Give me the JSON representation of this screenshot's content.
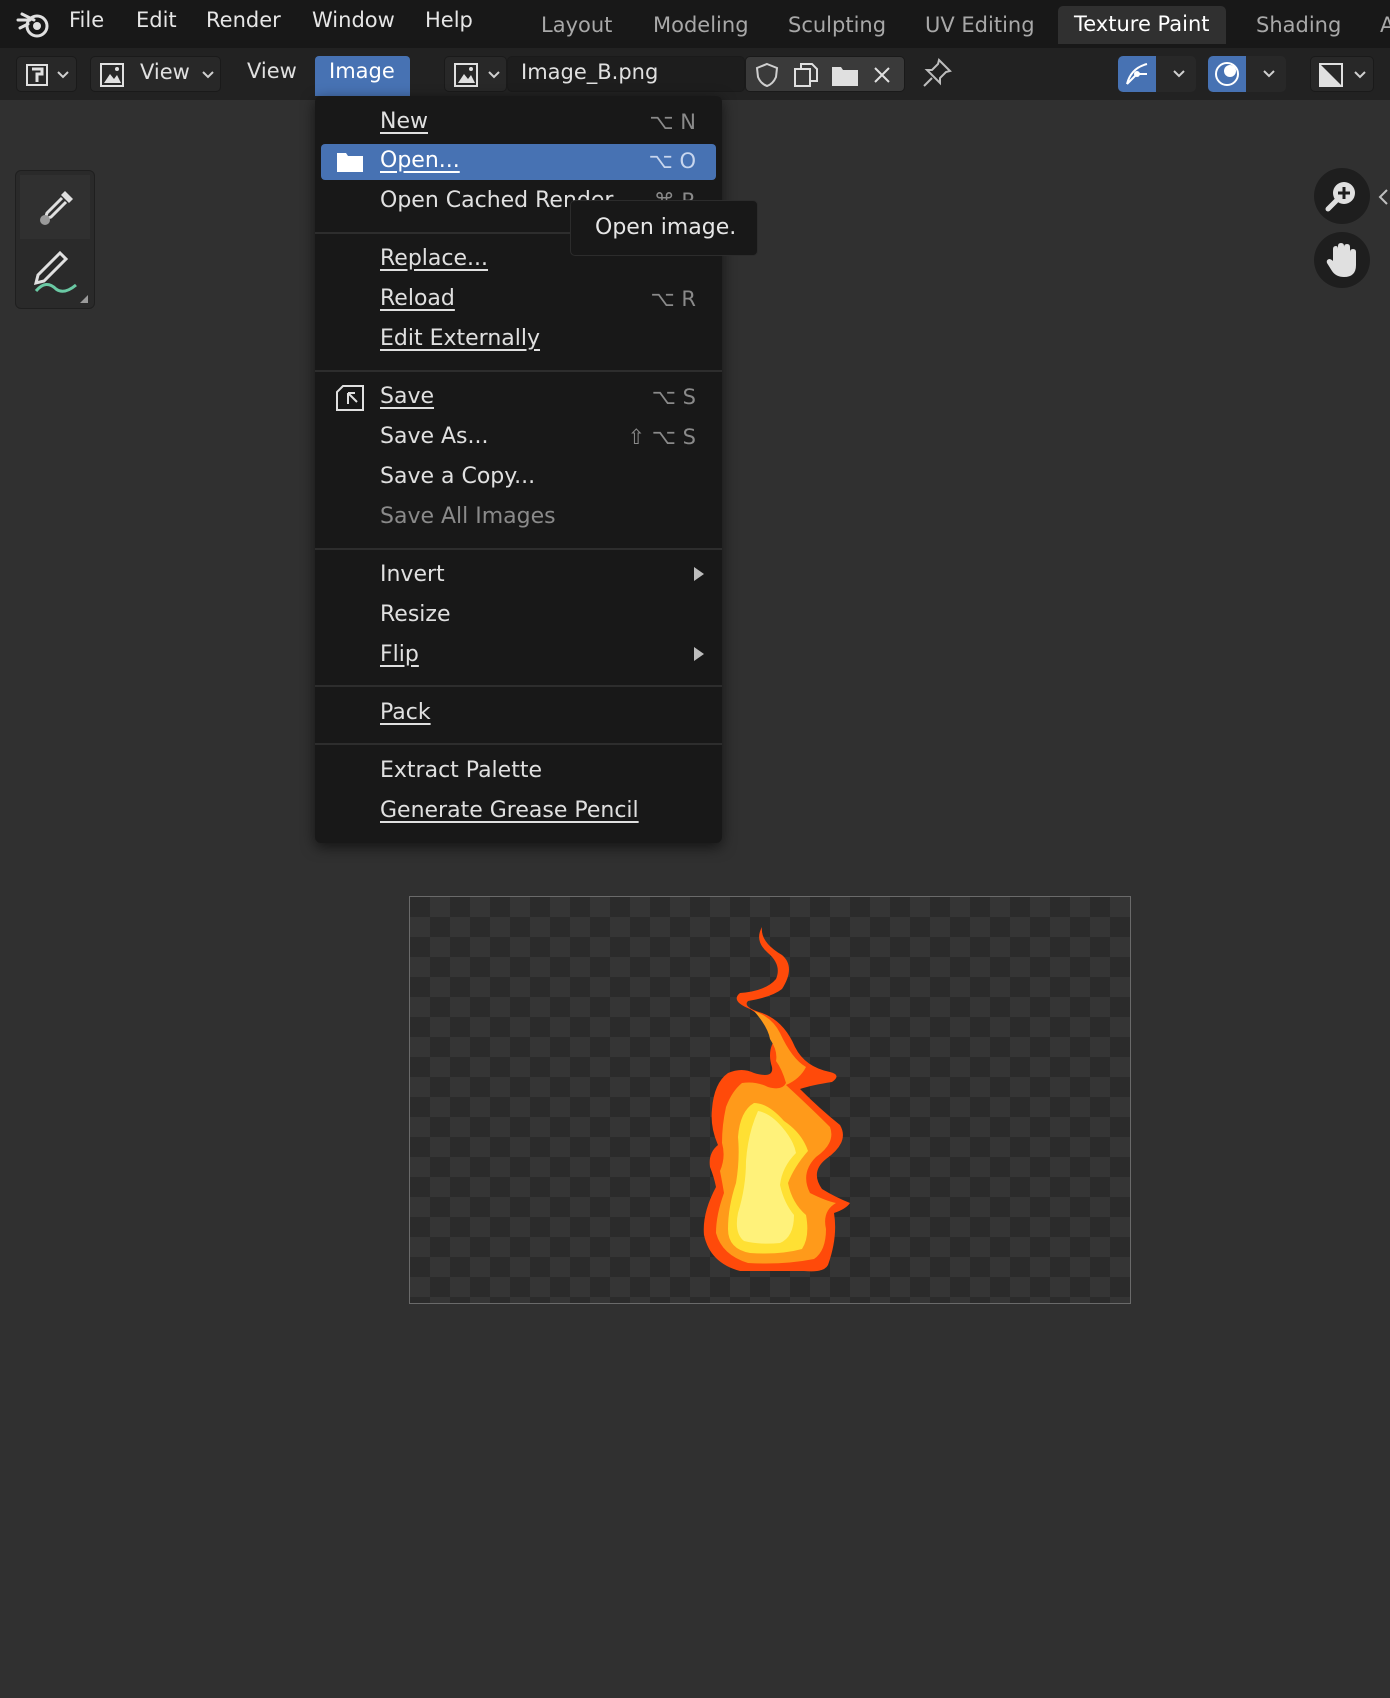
{
  "topbar": {
    "menus": [
      "File",
      "Edit",
      "Render",
      "Window",
      "Help"
    ],
    "workspaces": [
      "Layout",
      "Modeling",
      "Sculpting",
      "UV Editing",
      "Texture Paint",
      "Shading",
      "A"
    ],
    "active_workspace": "Texture Paint"
  },
  "header": {
    "view_dropdown": "View",
    "view_menu": "View",
    "image_menu": "Image",
    "image_name": "Image_B.png"
  },
  "image_menu": {
    "items": [
      {
        "label": "New",
        "shortcut": "⌥ N"
      },
      {
        "label": "Open...",
        "shortcut": "⌥ O"
      },
      {
        "label": "Open Cached Render",
        "shortcut": "⌘ R"
      },
      {
        "label": "Replace...",
        "shortcut": ""
      },
      {
        "label": "Reload",
        "shortcut": "⌥ R"
      },
      {
        "label": "Edit Externally",
        "shortcut": ""
      },
      {
        "label": "Save",
        "shortcut": "⌥ S"
      },
      {
        "label": "Save As...",
        "shortcut": "⇧ ⌥ S"
      },
      {
        "label": "Save a Copy...",
        "shortcut": ""
      },
      {
        "label": "Save All Images",
        "shortcut": ""
      },
      {
        "label": "Invert",
        "shortcut": ""
      },
      {
        "label": "Resize",
        "shortcut": ""
      },
      {
        "label": "Flip",
        "shortcut": ""
      },
      {
        "label": "Pack",
        "shortcut": ""
      },
      {
        "label": "Extract Palette",
        "shortcut": ""
      },
      {
        "label": "Generate Grease Pencil",
        "shortcut": ""
      }
    ],
    "highlighted": "Open...",
    "disabled": "Save All Images"
  },
  "tooltip": {
    "text": "Open image."
  },
  "colors": {
    "accent": "#4772b3",
    "menu_bg": "#181818",
    "viewport_bg": "#303030"
  }
}
